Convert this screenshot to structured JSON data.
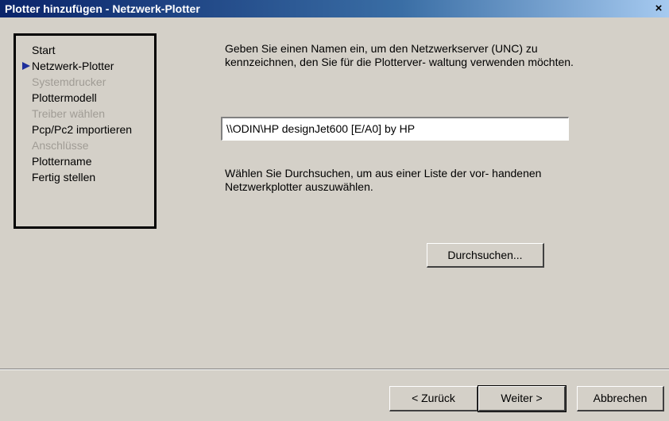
{
  "window": {
    "title": "Plotter hinzufügen - Netzwerk-Plotter",
    "close_glyph": "×"
  },
  "steps": [
    {
      "label": "Start",
      "state": "enabled"
    },
    {
      "label": "Netzwerk-Plotter",
      "state": "current"
    },
    {
      "label": "Systemdrucker",
      "state": "disabled"
    },
    {
      "label": "Plottermodell",
      "state": "enabled"
    },
    {
      "label": "Treiber wählen",
      "state": "disabled"
    },
    {
      "label": "Pcp/Pc2 importieren",
      "state": "enabled"
    },
    {
      "label": "Anschlüsse",
      "state": "disabled"
    },
    {
      "label": "Plottername",
      "state": "enabled"
    },
    {
      "label": "Fertig stellen",
      "state": "enabled"
    }
  ],
  "main": {
    "intro_text": "Geben Sie einen Namen ein, um den Netzwerkserver (UNC) zu kennzeichnen, den Sie für die Plotterver- waltung verwenden möchten.",
    "server_name_value": "\\\\ODIN\\HP designJet600 [E/A0] by HP",
    "browse_text": "Wählen Sie Durchsuchen, um aus einer Liste der vor- handenen Netzwerkplotter auszuwählen.",
    "browse_button": "Durchsuchen..."
  },
  "footer": {
    "back_button": "< Zurück",
    "next_button": "Weiter >",
    "cancel_button": "Abbrechen"
  }
}
